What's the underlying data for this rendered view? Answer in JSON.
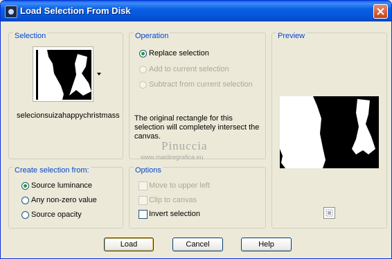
{
  "window": {
    "title": "Load Selection From Disk"
  },
  "selection_group": {
    "label": "Selection",
    "selection_name": "selecionsuizahappychristmass"
  },
  "operation_group": {
    "label": "Operation",
    "options": [
      {
        "label": "Replace selection",
        "checked": true,
        "enabled": true
      },
      {
        "label": "Add to current selection",
        "checked": false,
        "enabled": false
      },
      {
        "label": "Subtract from current selection",
        "checked": false,
        "enabled": false
      }
    ],
    "description": "The original rectangle for this selection will completely intersect the canvas."
  },
  "watermark": {
    "name": "Pinuccia",
    "url": "www.maidiregrafica.eu"
  },
  "preview_group": {
    "label": "Preview"
  },
  "create_from_group": {
    "label": "Create selection from:",
    "options": [
      {
        "label": "Source luminance",
        "checked": true
      },
      {
        "label": "Any non-zero value",
        "checked": false
      },
      {
        "label": "Source opacity",
        "checked": false
      }
    ]
  },
  "options_group": {
    "label": "Options",
    "items": [
      {
        "label": "Move to upper left",
        "checked": false,
        "enabled": false
      },
      {
        "label": "Clip to canvas",
        "checked": false,
        "enabled": false
      },
      {
        "label": "Invert selection",
        "checked": false,
        "enabled": true
      }
    ]
  },
  "buttons": {
    "load": "Load",
    "cancel": "Cancel",
    "help": "Help"
  },
  "colors": {
    "titlebar": "#0a5fe4",
    "group_label": "#0046d5",
    "dialog_bg": "#ece9d8",
    "checked_radio": "#21a121"
  }
}
